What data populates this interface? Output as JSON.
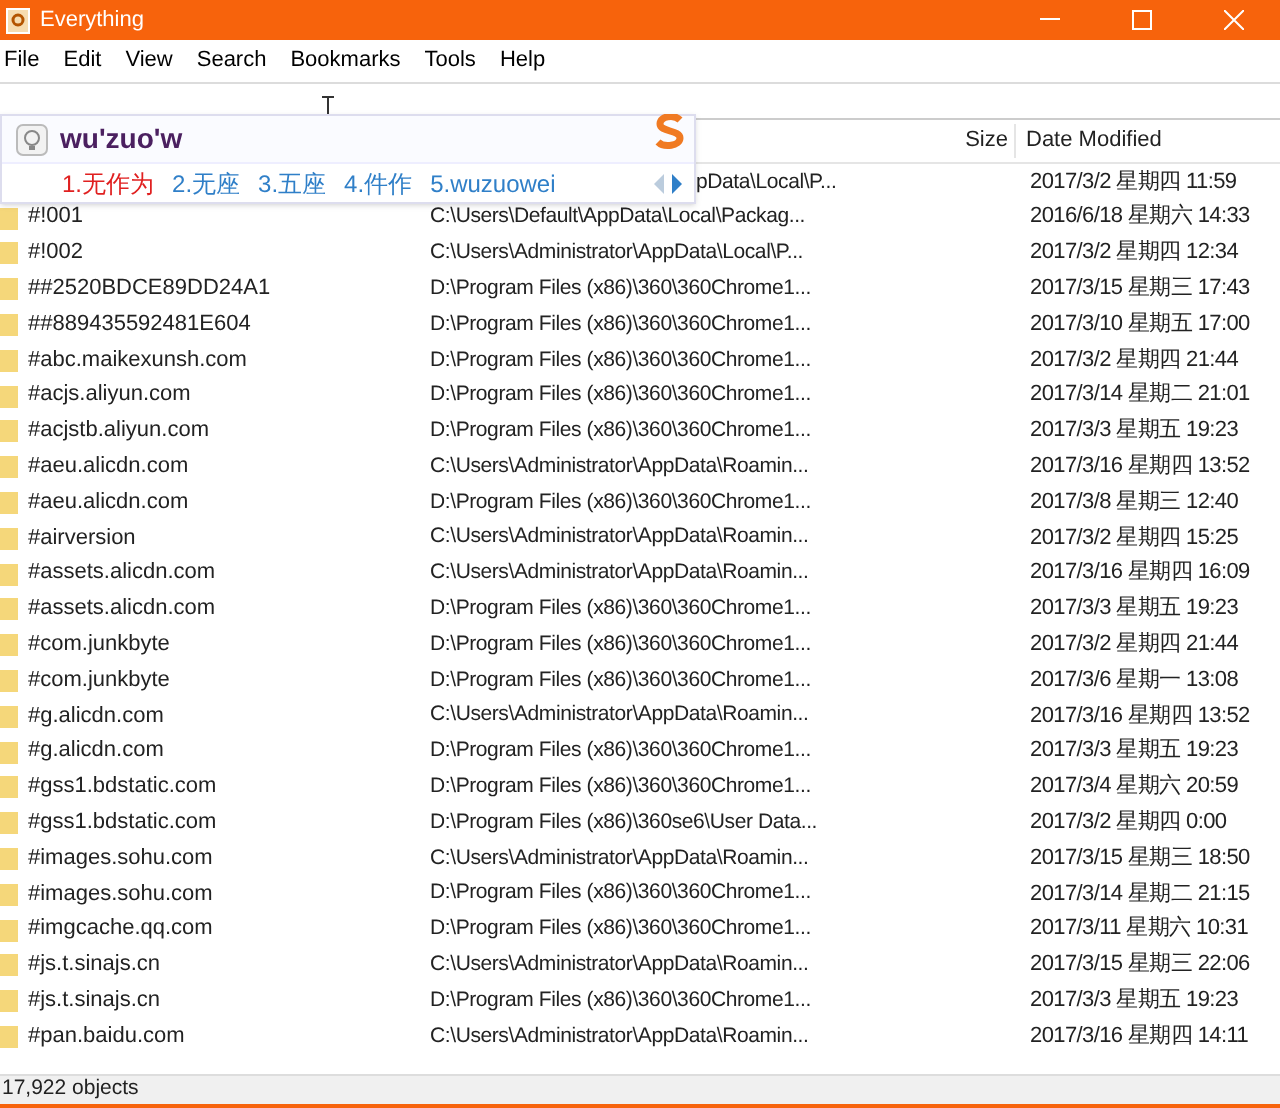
{
  "window": {
    "title": "Everything"
  },
  "menu": [
    "File",
    "Edit",
    "View",
    "Search",
    "Bookmarks",
    "Tools",
    "Help"
  ],
  "header": {
    "size": "Size",
    "date_modified": "Date Modified"
  },
  "ime": {
    "input": "wu'zuo'w",
    "candidates": [
      {
        "label": "1.无作为",
        "selected": true
      },
      {
        "label": "2.无座",
        "selected": false
      },
      {
        "label": "3.五座",
        "selected": false
      },
      {
        "label": "4.件作",
        "selected": false
      },
      {
        "label": "5.wuzuowei",
        "selected": false
      }
    ]
  },
  "rows": [
    {
      "path": "pData\\Local\\P...",
      "date": "2017/3/2 星期四 11:59"
    },
    {
      "name": "#!001",
      "path": "C:\\Users\\Default\\AppData\\Local\\Packag...",
      "date": "2016/6/18 星期六 14:33"
    },
    {
      "name": "#!002",
      "path": "C:\\Users\\Administrator\\AppData\\Local\\P...",
      "date": "2017/3/2 星期四 12:34"
    },
    {
      "name": "##2520BDCE89DD24A1",
      "path": "D:\\Program Files (x86)\\360\\360Chrome1...",
      "date": "2017/3/15 星期三 17:43"
    },
    {
      "name": "##889435592481E604",
      "path": "D:\\Program Files (x86)\\360\\360Chrome1...",
      "date": "2017/3/10 星期五 17:00"
    },
    {
      "name": "#abc.maikexunsh.com",
      "path": "D:\\Program Files (x86)\\360\\360Chrome1...",
      "date": "2017/3/2 星期四 21:44"
    },
    {
      "name": "#acjs.aliyun.com",
      "path": "D:\\Program Files (x86)\\360\\360Chrome1...",
      "date": "2017/3/14 星期二 21:01"
    },
    {
      "name": "#acjstb.aliyun.com",
      "path": "D:\\Program Files (x86)\\360\\360Chrome1...",
      "date": "2017/3/3 星期五 19:23"
    },
    {
      "name": "#aeu.alicdn.com",
      "path": "C:\\Users\\Administrator\\AppData\\Roamin...",
      "date": "2017/3/16 星期四 13:52"
    },
    {
      "name": "#aeu.alicdn.com",
      "path": "D:\\Program Files (x86)\\360\\360Chrome1...",
      "date": "2017/3/8 星期三 12:40"
    },
    {
      "name": "#airversion",
      "path": "C:\\Users\\Administrator\\AppData\\Roamin...",
      "date": "2017/3/2 星期四 15:25"
    },
    {
      "name": "#assets.alicdn.com",
      "path": "C:\\Users\\Administrator\\AppData\\Roamin...",
      "date": "2017/3/16 星期四 16:09"
    },
    {
      "name": "#assets.alicdn.com",
      "path": "D:\\Program Files (x86)\\360\\360Chrome1...",
      "date": "2017/3/3 星期五 19:23"
    },
    {
      "name": "#com.junkbyte",
      "path": "D:\\Program Files (x86)\\360\\360Chrome1...",
      "date": "2017/3/2 星期四 21:44"
    },
    {
      "name": "#com.junkbyte",
      "path": "D:\\Program Files (x86)\\360\\360Chrome1...",
      "date": "2017/3/6 星期一 13:08"
    },
    {
      "name": "#g.alicdn.com",
      "path": "C:\\Users\\Administrator\\AppData\\Roamin...",
      "date": "2017/3/16 星期四 13:52"
    },
    {
      "name": "#g.alicdn.com",
      "path": "D:\\Program Files (x86)\\360\\360Chrome1...",
      "date": "2017/3/3 星期五 19:23"
    },
    {
      "name": "#gss1.bdstatic.com",
      "path": "D:\\Program Files (x86)\\360\\360Chrome1...",
      "date": "2017/3/4 星期六 20:59"
    },
    {
      "name": "#gss1.bdstatic.com",
      "path": "D:\\Program Files (x86)\\360se6\\User Data...",
      "date": "2017/3/2 星期四 0:00"
    },
    {
      "name": "#images.sohu.com",
      "path": "C:\\Users\\Administrator\\AppData\\Roamin...",
      "date": "2017/3/15 星期三 18:50"
    },
    {
      "name": "#images.sohu.com",
      "path": "D:\\Program Files (x86)\\360\\360Chrome1...",
      "date": "2017/3/14 星期二 21:15"
    },
    {
      "name": "#imgcache.qq.com",
      "path": "D:\\Program Files (x86)\\360\\360Chrome1...",
      "date": "2017/3/11 星期六 10:31"
    },
    {
      "name": "#js.t.sinajs.cn",
      "path": "C:\\Users\\Administrator\\AppData\\Roamin...",
      "date": "2017/3/15 星期三 22:06"
    },
    {
      "name": "#js.t.sinajs.cn",
      "path": "D:\\Program Files (x86)\\360\\360Chrome1...",
      "date": "2017/3/3 星期五 19:23"
    },
    {
      "name": "#pan.baidu.com",
      "path": "C:\\Users\\Administrator\\AppData\\Roamin...",
      "date": "2017/3/16 星期四 14:11"
    }
  ],
  "status_bar": "17,922 objects"
}
